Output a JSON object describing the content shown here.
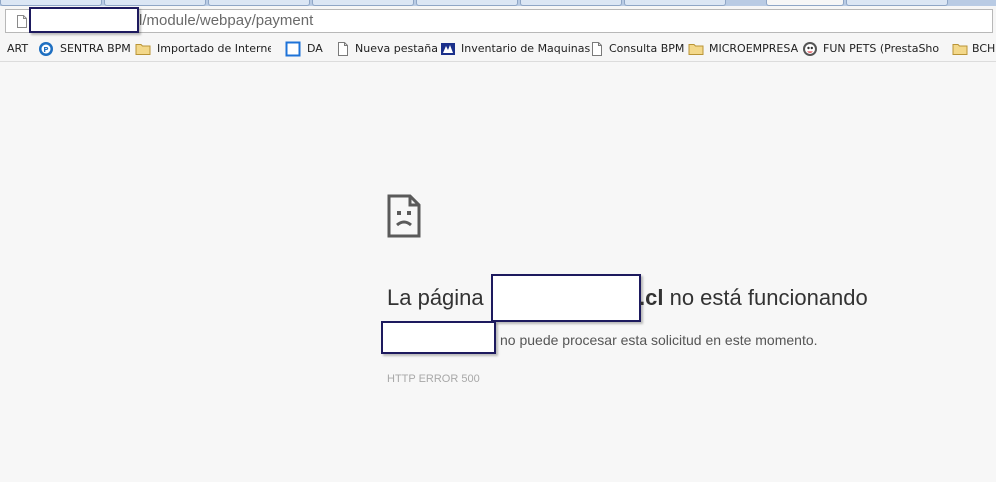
{
  "address_bar": {
    "url_suffix": "l/module/webpay/payment"
  },
  "bookmarks": [
    {
      "label": "ART",
      "icon": "none"
    },
    {
      "label": "SENTRA BPM",
      "icon": "sentra-gear-icon"
    },
    {
      "label": "Importado de Internet E",
      "icon": "folder-icon"
    },
    {
      "label": "DA",
      "icon": "blue-square-icon"
    },
    {
      "label": "Nueva pestaña",
      "icon": "page-icon"
    },
    {
      "label": "Inventario de Maquinas",
      "icon": "inventory-icon"
    },
    {
      "label": "Consulta BPM",
      "icon": "page-icon"
    },
    {
      "label": "MICROEMPRESA",
      "icon": "folder-icon"
    },
    {
      "label": "FUN PETS (PrestaShop™",
      "icon": "prestashop-icon"
    },
    {
      "label": "BCH",
      "icon": "folder-icon"
    }
  ],
  "error": {
    "title_prefix": "La página",
    "title_domain_tail": ".cl",
    "title_suffix": "no está funcionando",
    "description": "no puede procesar esta solicitud en este momento.",
    "code": "HTTP ERROR 500",
    "icon": "sad-page-icon"
  },
  "colors": {
    "redaction_border": "#1d1a5e",
    "page_background": "#f7f7f7",
    "folder": "#e8c26a"
  }
}
